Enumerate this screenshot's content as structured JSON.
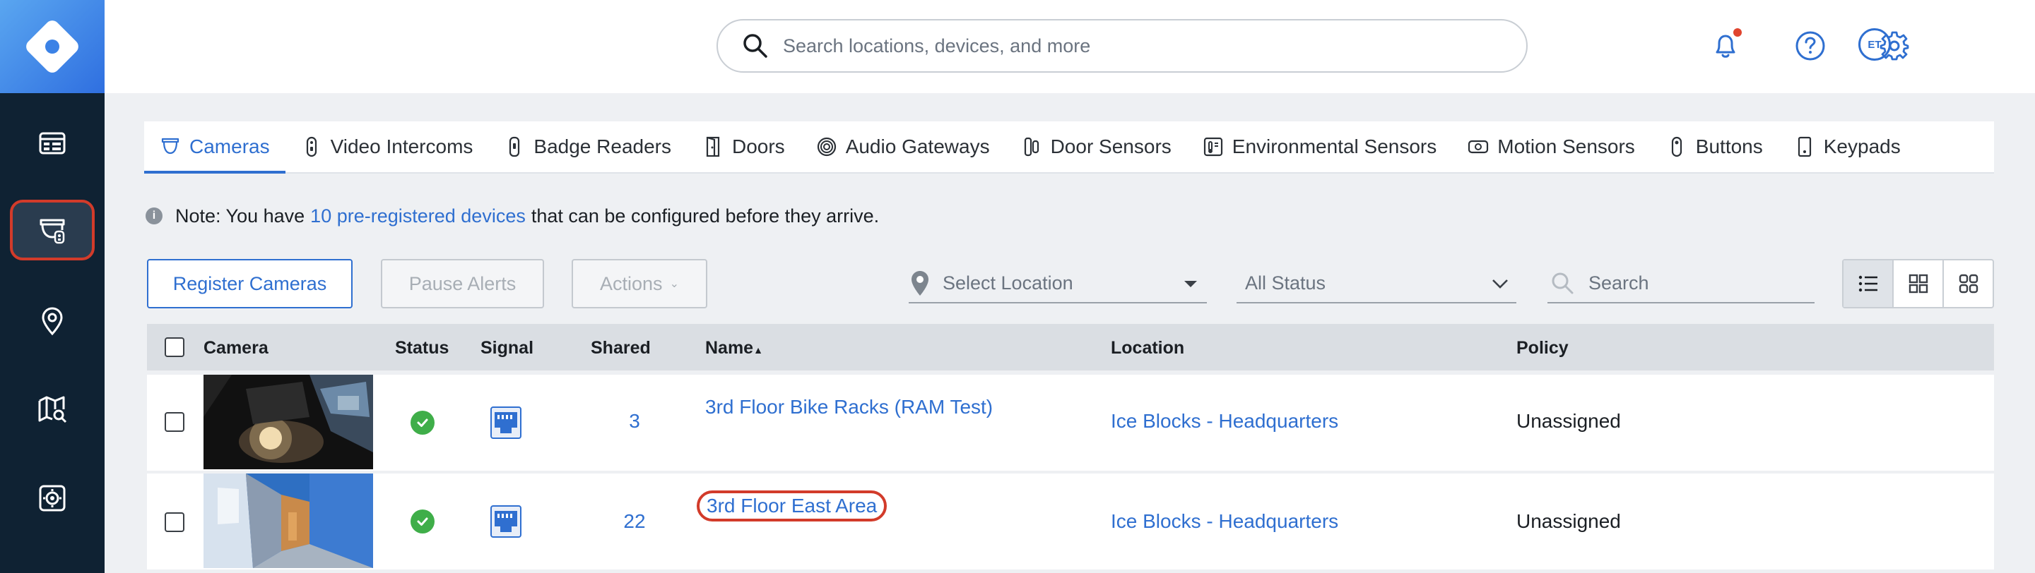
{
  "search": {
    "placeholder": "Search locations, devices, and more"
  },
  "user": {
    "initials": "ET"
  },
  "sidebar": {
    "items": [
      {
        "icon": "dashboard-icon"
      },
      {
        "icon": "camera-icon",
        "active": true
      },
      {
        "icon": "location-pin-icon"
      },
      {
        "icon": "map-search-icon"
      },
      {
        "icon": "safe-icon"
      }
    ]
  },
  "tabs": [
    {
      "label": "Cameras",
      "icon": "camera-icon",
      "active": true
    },
    {
      "label": "Video Intercoms",
      "icon": "intercom-icon"
    },
    {
      "label": "Badge Readers",
      "icon": "badge-reader-icon"
    },
    {
      "label": "Doors",
      "icon": "door-icon"
    },
    {
      "label": "Audio Gateways",
      "icon": "audio-gateway-icon"
    },
    {
      "label": "Door Sensors",
      "icon": "door-sensor-icon"
    },
    {
      "label": "Environmental Sensors",
      "icon": "environmental-sensor-icon"
    },
    {
      "label": "Motion Sensors",
      "icon": "motion-sensor-icon"
    },
    {
      "label": "Buttons",
      "icon": "button-device-icon"
    },
    {
      "label": "Keypads",
      "icon": "keypad-icon"
    }
  ],
  "note": {
    "prefix": "Note: You have",
    "link": "10 pre-registered devices",
    "suffix": "that can be configured before they arrive."
  },
  "toolbar": {
    "register": "Register Cameras",
    "pause": "Pause Alerts",
    "actions": "Actions",
    "location_placeholder": "Select Location",
    "status_value": "All Status",
    "search_placeholder": "Search"
  },
  "table": {
    "headers": {
      "camera": "Camera",
      "status": "Status",
      "signal": "Signal",
      "shared": "Shared",
      "name": "Name",
      "sort_indicator": "▲",
      "location": "Location",
      "policy": "Policy"
    },
    "rows": [
      {
        "shared": "3",
        "name": "3rd Floor Bike Racks (RAM Test)",
        "location": "Ice Blocks - Headquarters",
        "policy": "Unassigned"
      },
      {
        "shared": "22",
        "name": "3rd Floor East Area",
        "location": "Ice Blocks - Headquarters",
        "policy": "Unassigned"
      }
    ]
  },
  "colors": {
    "accent": "#2f6fd0",
    "sidebar": "#0f2233",
    "status_ok": "#3fae49",
    "highlight": "#d23b2a"
  }
}
